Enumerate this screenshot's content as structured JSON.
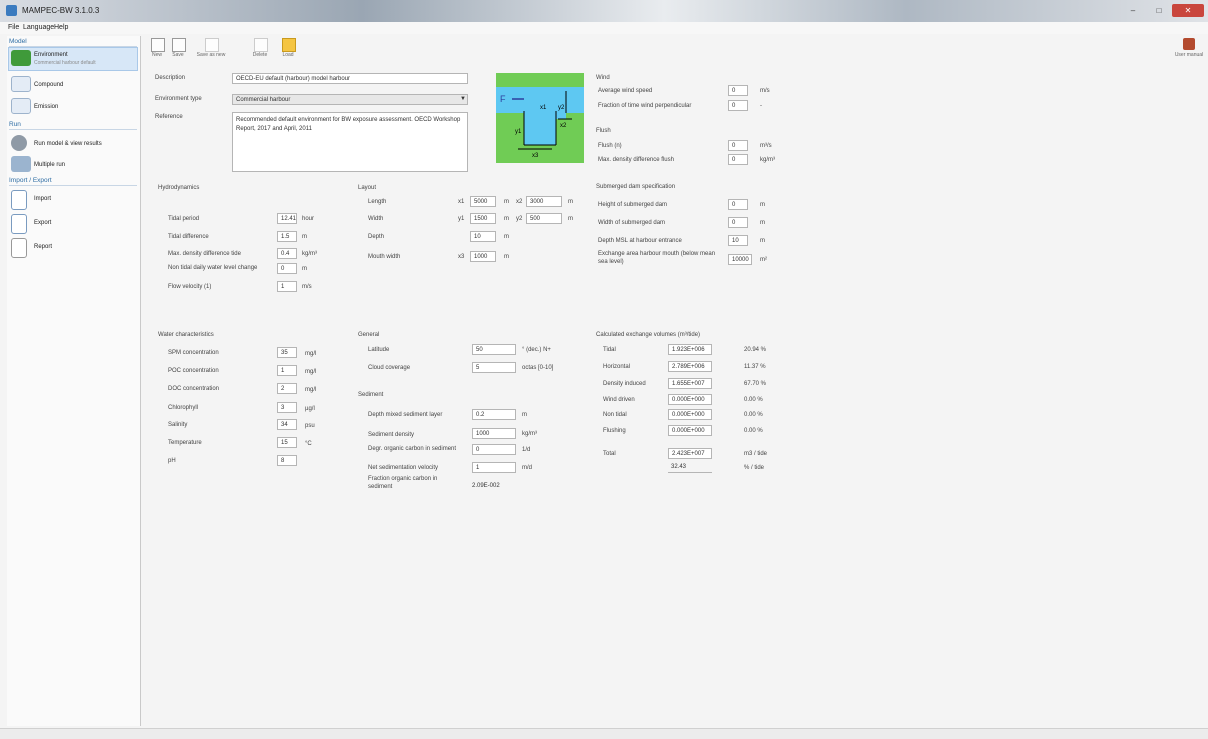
{
  "window": {
    "title": "MAMPEC-BW 3.1.0.3"
  },
  "menu": [
    "File",
    "Language",
    "Help"
  ],
  "sidebar": {
    "sections": [
      "Model",
      "Run",
      "Import / Export"
    ],
    "items": [
      {
        "label": "Environment",
        "sub": "Commercial harbour default"
      },
      {
        "label": "Compound"
      },
      {
        "label": "Emission"
      },
      {
        "label": "Run model & view results"
      },
      {
        "label": "Multiple run"
      },
      {
        "label": "Import"
      },
      {
        "label": "Export"
      },
      {
        "label": "Report"
      }
    ]
  },
  "toolbar": [
    "New",
    "Save",
    "Save as new",
    "Delete",
    "Load"
  ],
  "user_manual": "User manual",
  "env": {
    "description_label": "Description",
    "description": "OECD-EU default (harbour) model harbour",
    "type_label": "Environment type",
    "type": "Commercial harbour",
    "reference_label": "Reference",
    "reference": "Recommended default environment for BW exposure assessment. OECD Workshop Report, 2017 and April, 2011"
  },
  "hydro": {
    "title": "Hydrodynamics",
    "rows": [
      {
        "label": "Tidal period",
        "value": "12.41",
        "unit": "hour"
      },
      {
        "label": "Tidal difference",
        "value": "1.5",
        "unit": "m"
      },
      {
        "label": "Max. density difference tide",
        "value": "0.4",
        "unit": "kg/m³"
      },
      {
        "label": "Non tidal daily water level change",
        "value": "0",
        "unit": "m"
      },
      {
        "label": "Flow velocity (1)",
        "value": "1",
        "unit": "m/s"
      }
    ]
  },
  "layout": {
    "title": "Layout",
    "rows": [
      {
        "label": "Length",
        "k1": "x1",
        "v1": "5000",
        "u1": "m",
        "k2": "x2",
        "v2": "3000",
        "u2": "m"
      },
      {
        "label": "Width",
        "k1": "y1",
        "v1": "1500",
        "u1": "m",
        "k2": "y2",
        "v2": "500",
        "u2": "m"
      },
      {
        "label": "Depth",
        "k1": "",
        "v1": "10",
        "u1": "m",
        "k2": "",
        "v2": "",
        "u2": ""
      },
      {
        "label": "Mouth width",
        "k1": "x3",
        "v1": "1000",
        "u1": "m",
        "k2": "",
        "v2": "",
        "u2": ""
      }
    ]
  },
  "wind": {
    "title": "Wind",
    "rows": [
      {
        "label": "Average wind speed",
        "value": "0",
        "unit": "m/s"
      },
      {
        "label": "Fraction of time wind perpendicular",
        "value": "0",
        "unit": "-"
      }
    ]
  },
  "flush": {
    "title": "Flush",
    "rows": [
      {
        "label": "Flush (n)",
        "value": "0",
        "unit": "m³/s"
      },
      {
        "label": "Max. density difference flush",
        "value": "0",
        "unit": "kg/m³"
      }
    ]
  },
  "submerged": {
    "title": "Submerged dam specification",
    "rows": [
      {
        "label": "Height of submerged dam",
        "value": "0",
        "unit": "m"
      },
      {
        "label": "Width of submerged dam",
        "value": "0",
        "unit": "m"
      },
      {
        "label": "Depth MSL at harbour entrance",
        "value": "10",
        "unit": "m"
      },
      {
        "label": "Exchange area harbour mouth (below mean sea level)",
        "value": "10000",
        "unit": "m²"
      }
    ]
  },
  "water": {
    "title": "Water characteristics",
    "rows": [
      {
        "label": "SPM concentration",
        "value": "35",
        "unit": "mg/l"
      },
      {
        "label": "POC concentration",
        "value": "1",
        "unit": "mg/l"
      },
      {
        "label": "DOC concentration",
        "value": "2",
        "unit": "mg/l"
      },
      {
        "label": "Chlorophyll",
        "value": "3",
        "unit": "µg/l"
      },
      {
        "label": "Salinity",
        "value": "34",
        "unit": "psu"
      },
      {
        "label": "Temperature",
        "value": "15",
        "unit": "°C"
      },
      {
        "label": "pH",
        "value": "8",
        "unit": ""
      }
    ]
  },
  "general": {
    "title": "General",
    "rows": [
      {
        "label": "Latitude",
        "value": "50",
        "unit": "° (dec.) N+"
      },
      {
        "label": "Cloud coverage",
        "value": "5",
        "unit": "octas [0-10]"
      }
    ]
  },
  "sediment": {
    "title": "Sediment",
    "rows": [
      {
        "label": "Depth mixed sediment layer",
        "value": "0.2",
        "unit": "m"
      },
      {
        "label": "Sediment density",
        "value": "1000",
        "unit": "kg/m³"
      },
      {
        "label": "Degr. organic carbon in sediment",
        "value": "0",
        "unit": "1/d"
      },
      {
        "label": "Net sedimentation velocity",
        "value": "1",
        "unit": "m/d"
      },
      {
        "label": "Fraction organic carbon in sediment",
        "value": "2.09E-002",
        "unit": ""
      }
    ]
  },
  "exchange": {
    "title": "Calculated exchange volumes (m³/tide)",
    "rows": [
      {
        "label": "Tidal",
        "value": "1.923E+006",
        "pct": "20.94 %"
      },
      {
        "label": "Horizontal",
        "value": "2.789E+006",
        "pct": "11.37 %"
      },
      {
        "label": "Density induced",
        "value": "1.655E+007",
        "pct": "67.70 %"
      },
      {
        "label": "Wind driven",
        "value": "0.000E+000",
        "pct": "0.00 %"
      },
      {
        "label": "Non tidal",
        "value": "0.000E+000",
        "pct": "0.00 %"
      },
      {
        "label": "Flushing",
        "value": "0.000E+000",
        "pct": "0.00 %"
      }
    ],
    "total_label": "Total",
    "total": "2.423E+007",
    "total_unit": "m3 / tide",
    "pct_value": "32.43",
    "pct_unit": "% / tide"
  },
  "diagram": {
    "labels": [
      "F",
      "y1",
      "y2",
      "x1",
      "x2",
      "x3"
    ]
  },
  "colors": {
    "accent": "#2e6da4",
    "diagram_green": "#70cc55",
    "diagram_water": "#5ec8f2"
  }
}
